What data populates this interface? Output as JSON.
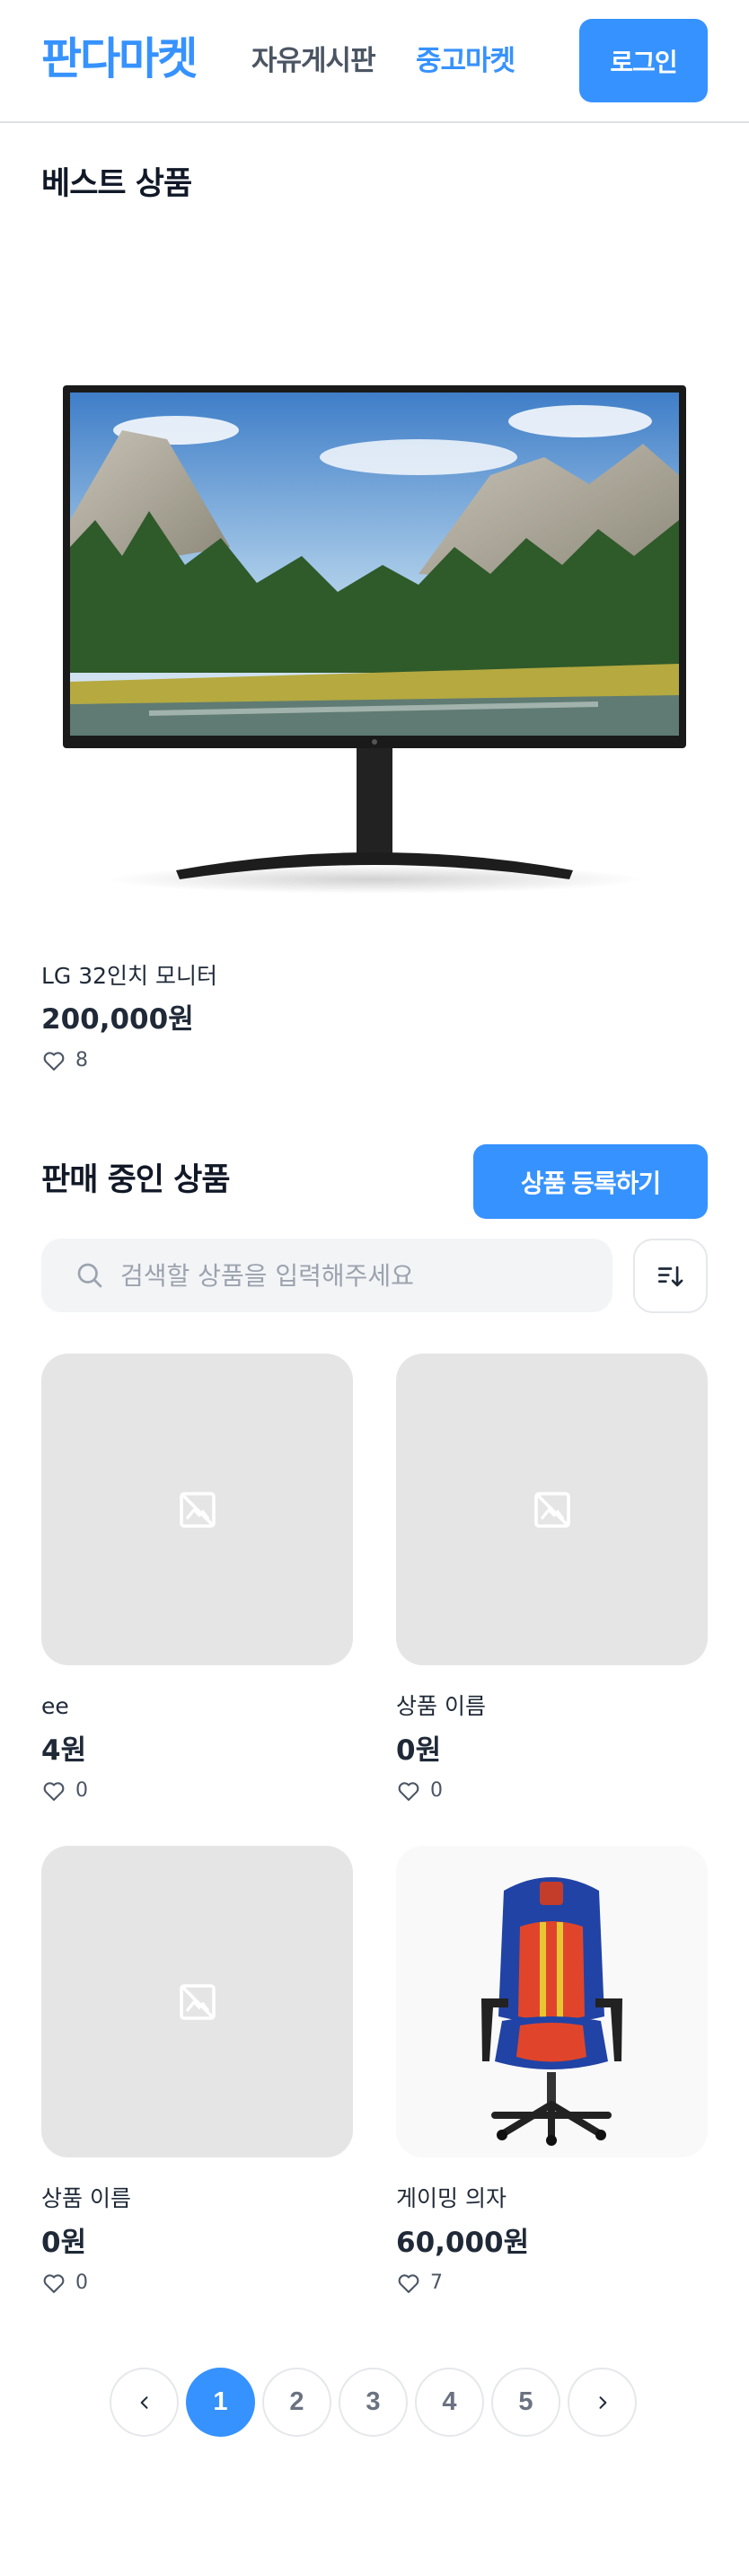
{
  "header": {
    "logo": "판다마켓",
    "nav": [
      {
        "label": "자유게시판"
      },
      {
        "label": "중고마켓"
      }
    ],
    "login_label": "로그인"
  },
  "best": {
    "title": "베스트 상품",
    "item": {
      "name": "LG 32인치 모니터",
      "price": "200,000원",
      "likes": "8",
      "image": "monitor"
    }
  },
  "selling": {
    "title": "판매 중인 상품",
    "register_label": "상품 등록하기",
    "search": {
      "placeholder": "검색할 상품을 입력해주세요",
      "value": ""
    },
    "sort_icon": "sort-icon",
    "items": [
      {
        "name": "ee",
        "price": "4원",
        "likes": "0",
        "image": "placeholder"
      },
      {
        "name": "상품 이름",
        "price": "0원",
        "likes": "0",
        "image": "placeholder"
      },
      {
        "name": "상품 이름",
        "price": "0원",
        "likes": "0",
        "image": "placeholder"
      },
      {
        "name": "게이밍 의자",
        "price": "60,000원",
        "likes": "7",
        "image": "gaming-chair"
      }
    ]
  },
  "pagination": {
    "prev": "‹",
    "next": "›",
    "pages": [
      "1",
      "2",
      "3",
      "4",
      "5"
    ],
    "current": 1
  },
  "colors": {
    "brand": "#3692ff",
    "placeholder_bg": "#e5e5e5",
    "text": "#1f2937"
  }
}
